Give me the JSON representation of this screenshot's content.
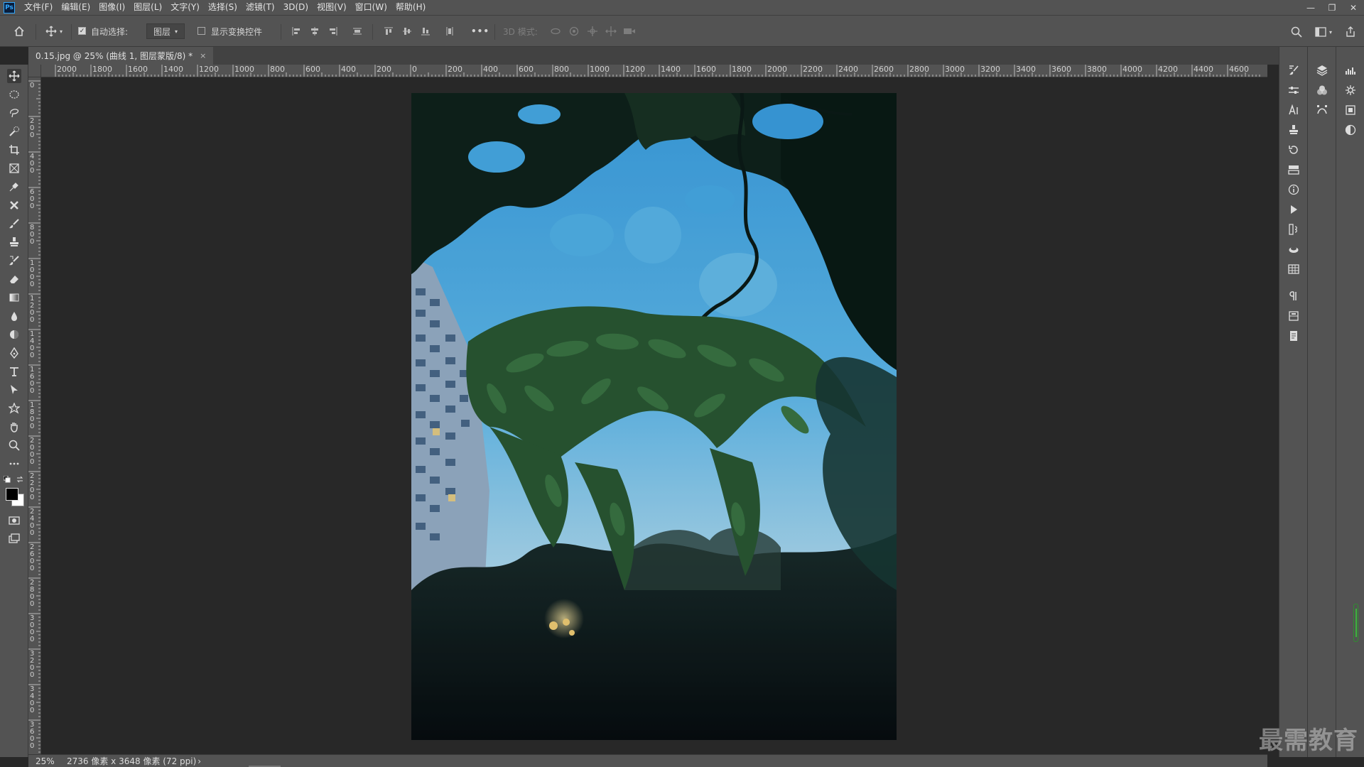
{
  "app": {
    "name": "Adobe Photoshop",
    "logo": "Ps"
  },
  "menu": [
    "文件(F)",
    "编辑(E)",
    "图像(I)",
    "图层(L)",
    "文字(Y)",
    "选择(S)",
    "滤镜(T)",
    "3D(D)",
    "视图(V)",
    "窗口(W)",
    "帮助(H)"
  ],
  "window_controls": {
    "minimize": "—",
    "restore": "❐",
    "close": "✕"
  },
  "options_bar": {
    "auto_select_label": "自动选择:",
    "auto_select_checked": true,
    "auto_select_target": "图层",
    "show_transform_label": "显示变换控件",
    "show_transform_checked": false,
    "more_label": "•••",
    "mode_3d_label": "3D 模式:"
  },
  "document_tab": {
    "title": "0.15.jpg @ 25% (曲线 1, 图层蒙版/8) *",
    "close": "×"
  },
  "ruler": {
    "horizontal_ticks": [
      "2000",
      "1800",
      "1600",
      "1400",
      "1200",
      "1000",
      "800",
      "600",
      "400",
      "200",
      "0",
      "200",
      "400",
      "600",
      "800",
      "1000",
      "1200",
      "1400",
      "1600",
      "1800",
      "2000",
      "2200",
      "2400",
      "2600",
      "2800",
      "3000",
      "3200",
      "3400",
      "3600",
      "3800",
      "4000",
      "4200",
      "4400",
      "4600"
    ],
    "vertical_ticks": [
      "0",
      "200",
      "400",
      "600",
      "800",
      "1000",
      "1200",
      "1400",
      "1600",
      "1800",
      "2000",
      "2200",
      "2400",
      "2600",
      "2800",
      "3000",
      "3200",
      "3400",
      "3600"
    ]
  },
  "status_bar": {
    "zoom": "25%",
    "doc_info": "2736 像素 x 3648 像素 (72 ppi)",
    "arrow": "›"
  },
  "watermark": "最需教育",
  "colors": {
    "ui_dark": "#282828",
    "ui_panel": "#535353",
    "accent": "#31a8ff"
  }
}
